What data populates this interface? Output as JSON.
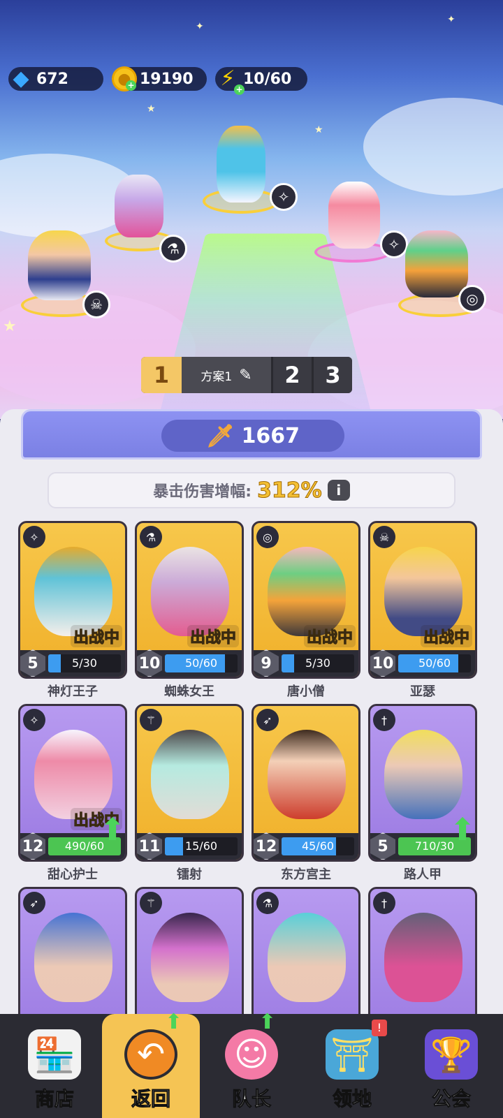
{
  "resources": {
    "gems": "672",
    "coins": "19190",
    "energy": "10/60"
  },
  "preset": {
    "tabs": [
      "1",
      "2",
      "3"
    ],
    "name": "方案1"
  },
  "power": "1667",
  "crit": {
    "label": "暴击伤害增幅:",
    "value": "312%",
    "info": "i"
  },
  "deployed_label_a": "出战",
  "deployed_label_b": "中",
  "cards": [
    {
      "name": "神灯王子",
      "level": "5",
      "progress": "5/30",
      "fill": 0.17,
      "deployed": true,
      "upgradable": false,
      "class_icon": "wings-icon",
      "bg": "gold"
    },
    {
      "name": "蜘蛛女王",
      "level": "10",
      "progress": "50/60",
      "fill": 0.83,
      "deployed": true,
      "upgradable": false,
      "class_icon": "potion-icon",
      "bg": "gold"
    },
    {
      "name": "唐小僧",
      "level": "9",
      "progress": "5/30",
      "fill": 0.17,
      "deployed": true,
      "upgradable": false,
      "class_icon": "swirl-icon",
      "bg": "gold"
    },
    {
      "name": "亚瑟",
      "level": "10",
      "progress": "50/60",
      "fill": 0.83,
      "deployed": true,
      "upgradable": false,
      "class_icon": "horned-skull-icon",
      "bg": "gold"
    },
    {
      "name": "甜心护士",
      "level": "12",
      "progress": "490/60",
      "fill": 1.0,
      "deployed": true,
      "upgradable": true,
      "class_icon": "wings-icon",
      "bg": "purple"
    },
    {
      "name": "镭射",
      "level": "11",
      "progress": "15/60",
      "fill": 0.25,
      "deployed": false,
      "upgradable": false,
      "class_icon": "staff-icon",
      "bg": "gold"
    },
    {
      "name": "东方宫主",
      "level": "12",
      "progress": "45/60",
      "fill": 0.75,
      "deployed": false,
      "upgradable": false,
      "class_icon": "bow-icon",
      "bg": "gold"
    },
    {
      "name": "路人甲",
      "level": "5",
      "progress": "710/30",
      "fill": 1.0,
      "deployed": false,
      "upgradable": true,
      "class_icon": "dagger-icon",
      "bg": "purple"
    },
    {
      "name": "",
      "level": "",
      "progress": "",
      "fill": 0,
      "deployed": false,
      "upgradable": false,
      "class_icon": "bow-icon",
      "bg": "purple"
    },
    {
      "name": "",
      "level": "",
      "progress": "",
      "fill": 0,
      "deployed": false,
      "upgradable": false,
      "class_icon": "staff-icon",
      "bg": "purple"
    },
    {
      "name": "",
      "level": "",
      "progress": "",
      "fill": 0,
      "deployed": false,
      "upgradable": false,
      "class_icon": "potion-icon",
      "bg": "purple"
    },
    {
      "name": "",
      "level": "",
      "progress": "",
      "fill": 0,
      "deployed": false,
      "upgradable": false,
      "class_icon": "dagger-icon",
      "bg": "purple"
    }
  ],
  "nav": [
    {
      "label": "商店",
      "icon": "shop-icon",
      "active": false
    },
    {
      "label": "返回",
      "icon": "return-icon",
      "active": true,
      "badge": "up"
    },
    {
      "label": "队长",
      "icon": "captain-icon",
      "active": false,
      "badge": "up"
    },
    {
      "label": "领地",
      "icon": "territory-icon",
      "active": false,
      "badge": "alert"
    },
    {
      "label": "公会",
      "icon": "guild-icon",
      "active": false
    }
  ],
  "alert_mark": "!",
  "colors": {
    "gold_card": "#f0b02a",
    "purple_card": "#9b7ae2",
    "active_tab": "#f5c454",
    "xp_bar": "#3d9cf0",
    "xp_bar_full": "#4cc552"
  }
}
